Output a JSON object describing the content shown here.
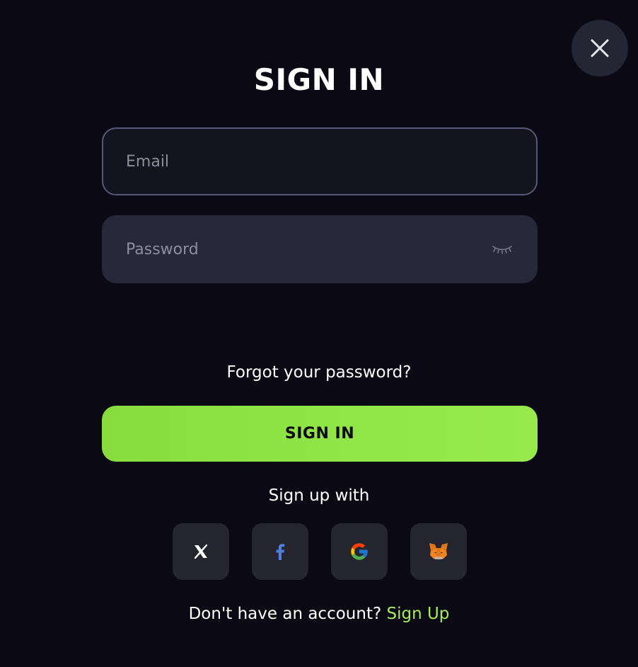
{
  "modal": {
    "title": "SIGN IN",
    "close_icon": "close-icon"
  },
  "form": {
    "email": {
      "placeholder": "Email",
      "value": ""
    },
    "password": {
      "placeholder": "Password",
      "value": "",
      "toggle_icon": "eye-closed-icon"
    },
    "forgot_label": "Forgot your password?",
    "submit_label": "SIGN IN"
  },
  "social": {
    "heading": "Sign up with",
    "providers": [
      {
        "name": "X",
        "icon": "x-logo-icon"
      },
      {
        "name": "Facebook",
        "icon": "facebook-icon"
      },
      {
        "name": "Google",
        "icon": "google-icon"
      },
      {
        "name": "MetaMask",
        "icon": "metamask-fox-icon"
      }
    ]
  },
  "footer": {
    "prompt": "Don't have an account?",
    "link_label": "Sign Up"
  },
  "colors": {
    "background": "#0b0a14",
    "accent": "#8fe446",
    "link": "#a6ea5e",
    "field_bg": "#272838"
  }
}
